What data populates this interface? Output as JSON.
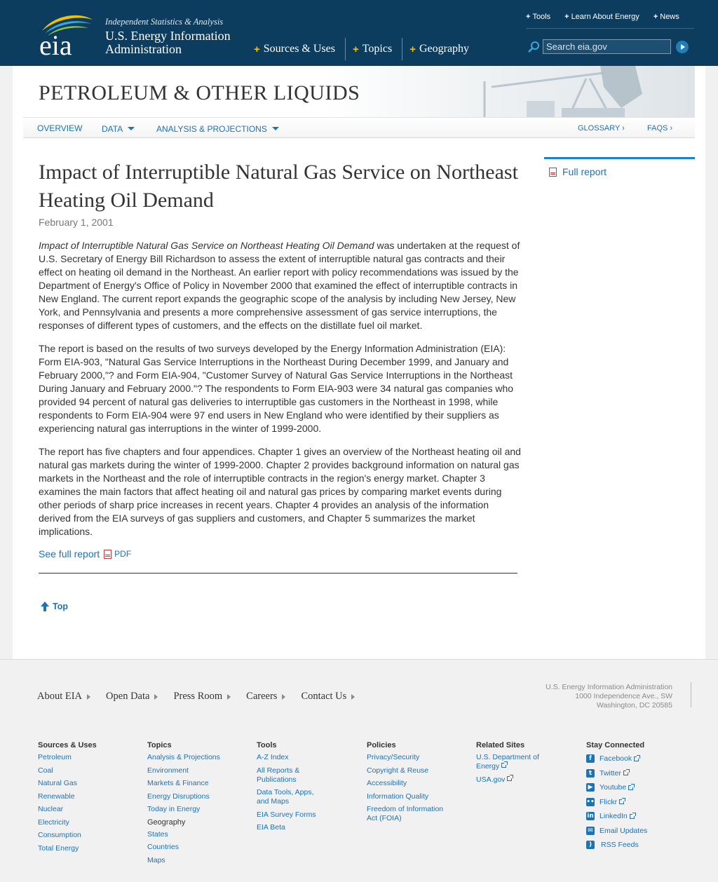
{
  "header": {
    "tagline": "Independent Statistics & Analysis",
    "org_name": "U.S. Energy Information Administration",
    "main_nav": [
      {
        "label": "Sources & Uses"
      },
      {
        "label": "Topics"
      },
      {
        "label": "Geography"
      }
    ],
    "util_nav": [
      {
        "label": "Tools"
      },
      {
        "label": "Learn About Energy"
      },
      {
        "label": "News"
      }
    ],
    "search": {
      "placeholder": "Search eia.gov"
    }
  },
  "section": {
    "title": "PETROLEUM & OTHER LIQUIDS",
    "subnav": {
      "overview": "OVERVIEW",
      "data": "DATA",
      "analysis": "ANALYSIS & PROJECTIONS",
      "glossary": "GLOSSARY ›",
      "faqs": "FAQS ›"
    }
  },
  "article": {
    "title": "Impact of Interruptible Natural Gas Service on Northeast Heating Oil Demand",
    "date": "February 1, 2001",
    "para1_italic": "Impact of Interruptible Natural Gas Service on Northeast Heating Oil Demand",
    "para1_rest": " was undertaken at the request of U.S. Secretary of Energy Bill Richardson to assess the extent of interruptible natural gas contracts and their effect on heating oil demand in the Northeast. An earlier report with policy recommendations was issued by the Department of Energy's Office of Policy in November 2000 that examined the effect of interruptible contracts in New England. The current report expands the geographic scope of the analysis by including New Jersey, New York, and Pennsylvania and presents a more comprehensive assessment of gas service interruptions, the responses of different types of customers, and the effects on the distillate fuel oil market.",
    "para2": "The report is based on the results of two surveys developed by the Energy Information Administration (EIA): Form EIA-903, \"Natural Gas Service Interruptions in the Northeast During December 1999, and January and February 2000,\"? and Form EIA-904, \"Customer Survey of Natural Gas Service Interruptions in the Northeast During January and February 2000.\"? The respondents to Form EIA-903 were 34 natural gas companies who provided 94 percent of natural gas deliveries to interruptible gas customers in the Northeast in 1998, while respondents to Form EIA-904 were 97 end users in New England who were identified by their suppliers as experiencing natural gas interruptions in the winter of 1999-2000.",
    "para3": "The report has five chapters and four appendices. Chapter 1 gives an overview of the Northeast heating oil and natural gas markets during the winter of 1999-2000. Chapter 2 provides background information on natural gas markets in the Northeast and the role of interruptible contracts in the region's energy market. Chapter 3 examines the main factors that affect heating oil and natural gas prices by comparing market events during other periods of sharp price increases in recent years. Chapter 4 provides an analysis of the information derived from the EIA surveys of gas suppliers and customers, and Chapter 5 summarizes the market implications.",
    "see_full_label": "See full report",
    "pdf_label": "PDF",
    "top_label": "Top"
  },
  "sidebar": {
    "full_report_label": "Full report"
  },
  "footer": {
    "nav": [
      {
        "label": "About EIA"
      },
      {
        "label": "Open Data"
      },
      {
        "label": "Press Room"
      },
      {
        "label": "Careers"
      },
      {
        "label": "Contact Us"
      }
    ],
    "address": {
      "line1": "U.S. Energy Information Administration",
      "line2": "1000 Independence Ave., SW",
      "line3": "Washington, DC 20585"
    },
    "columns": {
      "sources": {
        "head": "Sources & Uses",
        "links": [
          "Petroleum",
          "Coal",
          "Natural Gas",
          "Renewable",
          "Nuclear",
          "Electricity",
          "Consumption",
          "Total Energy"
        ]
      },
      "topics": {
        "head": "Topics",
        "links": [
          "Analysis & Projections",
          "Environment",
          "Markets & Finance",
          "Energy Disruptions",
          "Today in Energy"
        ],
        "subhead": "Geography",
        "sublinks": [
          "States",
          "Countries",
          "Maps"
        ]
      },
      "tools": {
        "head": "Tools",
        "links": [
          "A-Z Index",
          "All Reports & Publications",
          "Data Tools, Apps, and Maps",
          "EIA Survey Forms",
          "EIA Beta"
        ]
      },
      "policies": {
        "head": "Policies",
        "links": [
          "Privacy/Security",
          "Copyright & Reuse",
          "Accessibility",
          "Information Quality",
          "Freedom of Information Act (FOIA)"
        ]
      },
      "related": {
        "head": "Related Sites",
        "links": [
          "U.S. Department of Energy",
          "USA.gov"
        ]
      },
      "social": {
        "head": "Stay Connected",
        "links": [
          "Facebook",
          "Twitter",
          "Youtube",
          "Flickr",
          "LinkedIn",
          "Email Updates",
          "RSS Feeds"
        ]
      }
    }
  },
  "colors": {
    "header_bg": "#0d3d5e",
    "link": "#1d73b4",
    "accent_plus": "#f2c200",
    "sidebar_rule": "#1d83c4"
  },
  "icons": [
    "eia-logo",
    "search-icon",
    "search-go-icon",
    "pdf-icon",
    "up-arrow-icon",
    "external-link-icon",
    "facebook-icon",
    "twitter-icon",
    "youtube-icon",
    "flickr-icon",
    "linkedin-icon",
    "email-icon",
    "rss-icon"
  ]
}
